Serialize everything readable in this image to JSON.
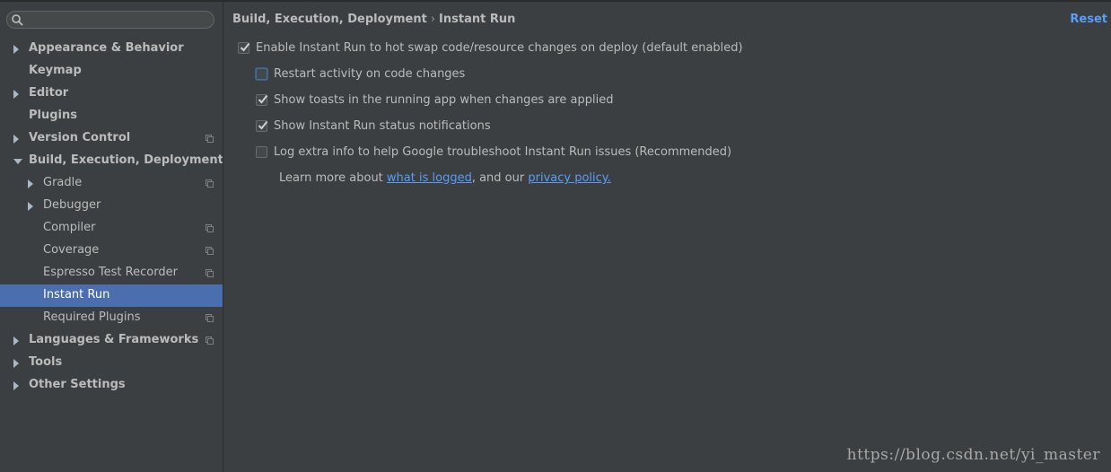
{
  "search": {
    "placeholder": ""
  },
  "sidebar": {
    "items": [
      {
        "label": "Appearance & Behavior",
        "level": 0,
        "arrow": "collapsed",
        "project_icon": false
      },
      {
        "label": "Keymap",
        "level": 0,
        "arrow": "none",
        "project_icon": false
      },
      {
        "label": "Editor",
        "level": 0,
        "arrow": "collapsed",
        "project_icon": false
      },
      {
        "label": "Plugins",
        "level": 0,
        "arrow": "none",
        "project_icon": false
      },
      {
        "label": "Version Control",
        "level": 0,
        "arrow": "collapsed",
        "project_icon": true
      },
      {
        "label": "Build, Execution, Deployment",
        "level": 0,
        "arrow": "expanded",
        "project_icon": false
      },
      {
        "label": "Gradle",
        "level": 1,
        "arrow": "collapsed",
        "project_icon": true
      },
      {
        "label": "Debugger",
        "level": 1,
        "arrow": "collapsed",
        "project_icon": false
      },
      {
        "label": "Compiler",
        "level": 1,
        "arrow": "none",
        "project_icon": true
      },
      {
        "label": "Coverage",
        "level": 1,
        "arrow": "none",
        "project_icon": true
      },
      {
        "label": "Espresso Test Recorder",
        "level": 1,
        "arrow": "none",
        "project_icon": true
      },
      {
        "label": "Instant Run",
        "level": 1,
        "arrow": "none",
        "project_icon": false,
        "selected": true
      },
      {
        "label": "Required Plugins",
        "level": 1,
        "arrow": "none",
        "project_icon": true
      },
      {
        "label": "Languages & Frameworks",
        "level": 0,
        "arrow": "collapsed",
        "project_icon": true
      },
      {
        "label": "Tools",
        "level": 0,
        "arrow": "collapsed",
        "project_icon": false
      },
      {
        "label": "Other Settings",
        "level": 0,
        "arrow": "collapsed",
        "project_icon": false
      }
    ]
  },
  "header": {
    "breadcrumb_parent": "Build, Execution, Deployment",
    "breadcrumb_separator": "›",
    "breadcrumb_current": "Instant Run",
    "reset_label": "Reset"
  },
  "options": {
    "enable_instant_run": {
      "label": "Enable Instant Run to hot swap code/resource changes on deploy (default enabled)",
      "checked": true
    },
    "restart_activity": {
      "label": "Restart activity on code changes",
      "checked": false
    },
    "show_toasts": {
      "label": "Show toasts in the running app when changes are applied",
      "checked": true
    },
    "show_status": {
      "label": "Show Instant Run status notifications",
      "checked": true
    },
    "log_extra": {
      "label": "Log extra info to help Google troubleshoot Instant Run issues (Recommended)",
      "checked": false
    }
  },
  "learn_more": {
    "prefix": "Learn more about ",
    "link1": "what is logged",
    "middle": ", and our ",
    "link2": "privacy policy."
  },
  "watermark": "https://blog.csdn.net/yi_master",
  "colors": {
    "background": "#3c3f41",
    "selection": "#4b6eaf",
    "link": "#589df6",
    "text": "#bbbbbb"
  }
}
